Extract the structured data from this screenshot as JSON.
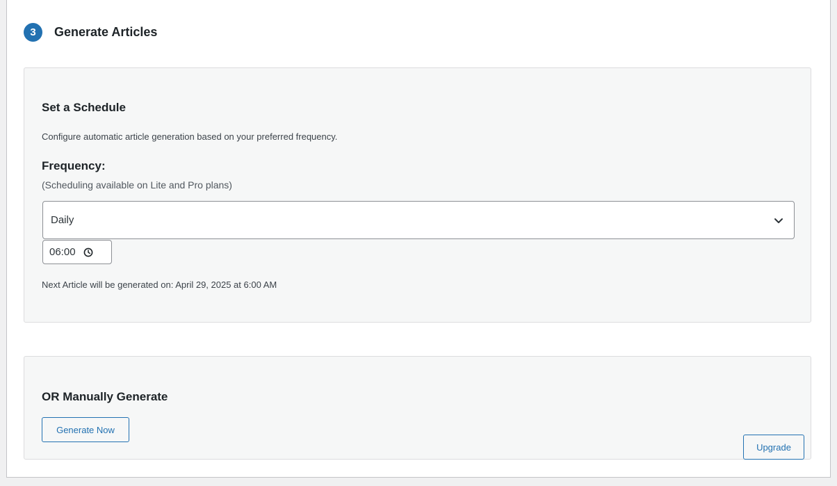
{
  "step": {
    "number": "3",
    "title": "Generate Articles"
  },
  "schedule": {
    "title": "Set a Schedule",
    "description": "Configure automatic article generation based on your preferred frequency.",
    "frequency_label": "Frequency:",
    "frequency_note": "(Scheduling available on Lite and Pro plans)",
    "frequency_selected": "Daily",
    "time_value": "06:00",
    "next_article_text": "Next Article will be generated on: April 29, 2025 at 6:00 AM"
  },
  "manual": {
    "title": "OR Manually Generate",
    "generate_button": "Generate Now",
    "upgrade_button": "Upgrade"
  },
  "colors": {
    "accent": "#2271b1",
    "panel_bg": "#f6f7f7",
    "page_bg": "#f0f0f1"
  },
  "icons": {
    "select_arrow": "chevron-down-icon",
    "time": "clock-icon"
  }
}
